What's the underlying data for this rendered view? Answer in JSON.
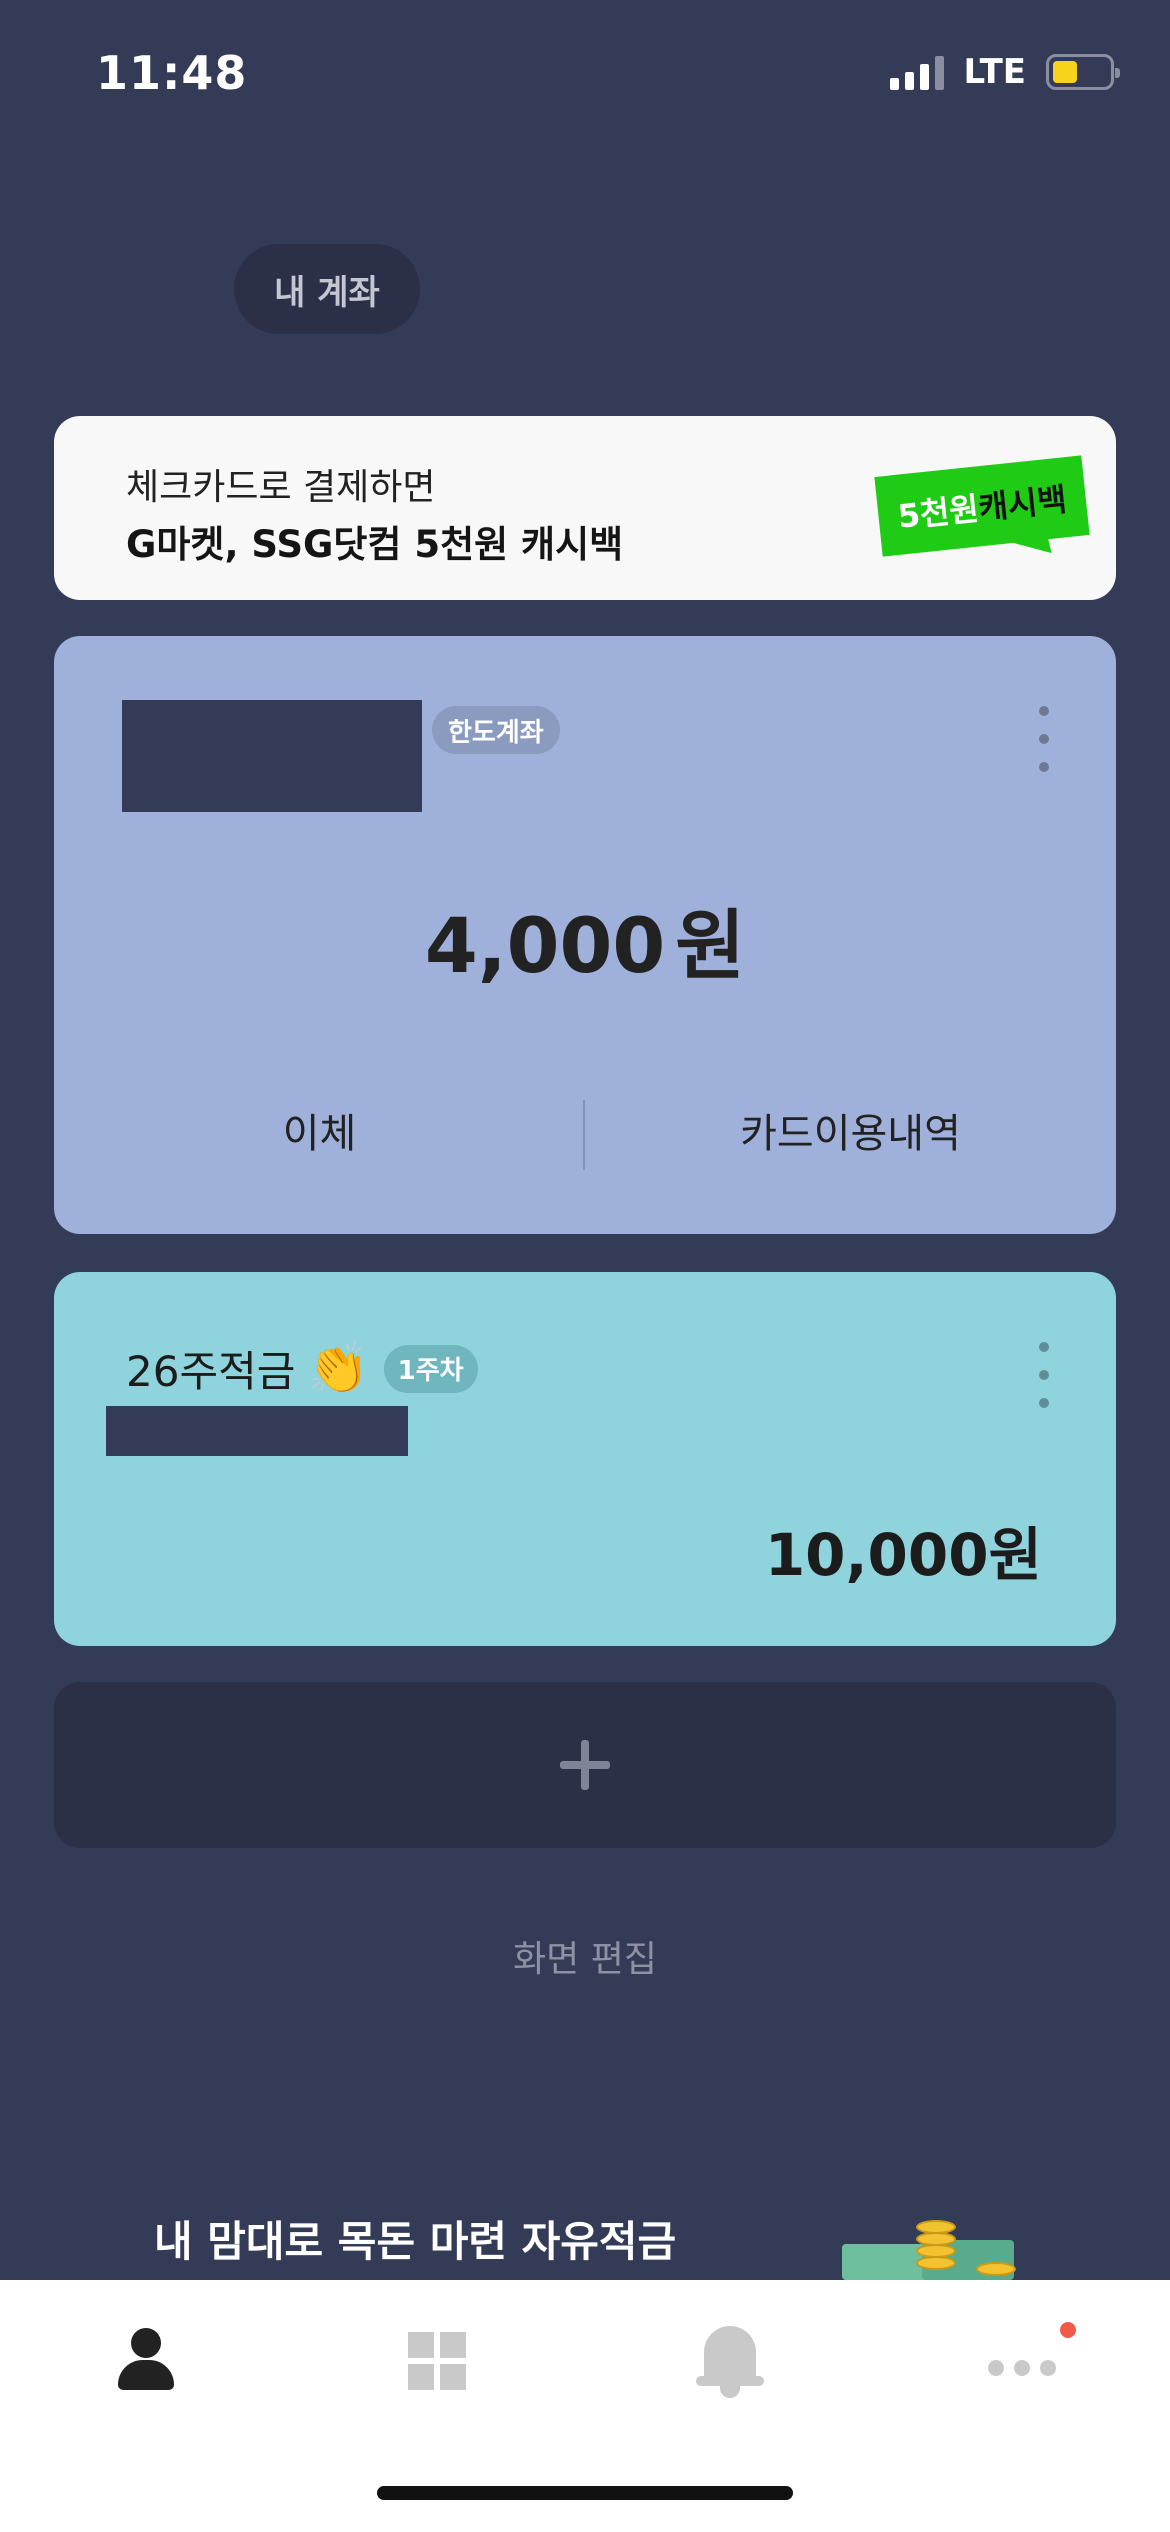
{
  "status_bar": {
    "time": "11:48",
    "network": "LTE"
  },
  "header": {
    "chip_label": "내 계좌"
  },
  "banner": {
    "line1": "체크카드로 결제하면",
    "line2": "G마켓, SSG닷컴 5천원 캐시백",
    "promo_amount": "5천원",
    "promo_text": "캐시백",
    "accent_color": "#1fcb15"
  },
  "accounts": [
    {
      "type_badge": "한도계좌",
      "balance": "4,000",
      "currency": "원",
      "actions": [
        "이체",
        "카드이용내역"
      ],
      "card_color": "#9fb1da"
    },
    {
      "title": "26주적금",
      "emoji": "👏",
      "week_badge": "1주차",
      "balance": "10,000원",
      "card_color": "#8fd3dd"
    }
  ],
  "edit_screen_label": "화면 편집",
  "promo_section": {
    "title": "내 맘대로 목돈 마련 자유적금"
  },
  "tab_bar": {
    "tabs": [
      {
        "icon": "person-icon",
        "active": true
      },
      {
        "icon": "grid-icon",
        "active": false
      },
      {
        "icon": "bell-icon",
        "active": false
      },
      {
        "icon": "more-icon",
        "active": false,
        "has_notification": true
      }
    ]
  }
}
